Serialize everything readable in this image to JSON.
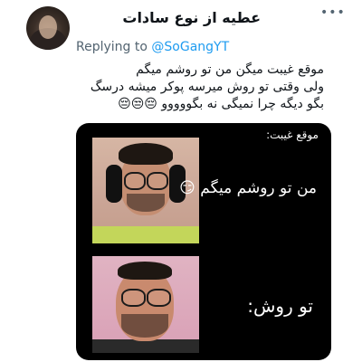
{
  "tweet": {
    "display_name": "عطیه از نوع سادات",
    "more_icon": "more-icon",
    "reply_prefix": "Replying to",
    "reply_handle": "@SoGangYT",
    "text_lines": [
      "موقع غیبت میگن من تو روشم میگم",
      "ولی وقتی تو روش میرسه پوکر میشه  ‌درسگ",
      "بگو دیگه چرا نمیگی نه بگووووو 😔😒😔"
    ]
  },
  "media": {
    "caption_top": "موقع غیبت:",
    "caption_1": "من تو روشم میگم 😏",
    "caption_2": "تو روش:"
  },
  "colors": {
    "link": "#1d9bf0",
    "secondary_text": "#536471",
    "media_background": "#000000"
  }
}
